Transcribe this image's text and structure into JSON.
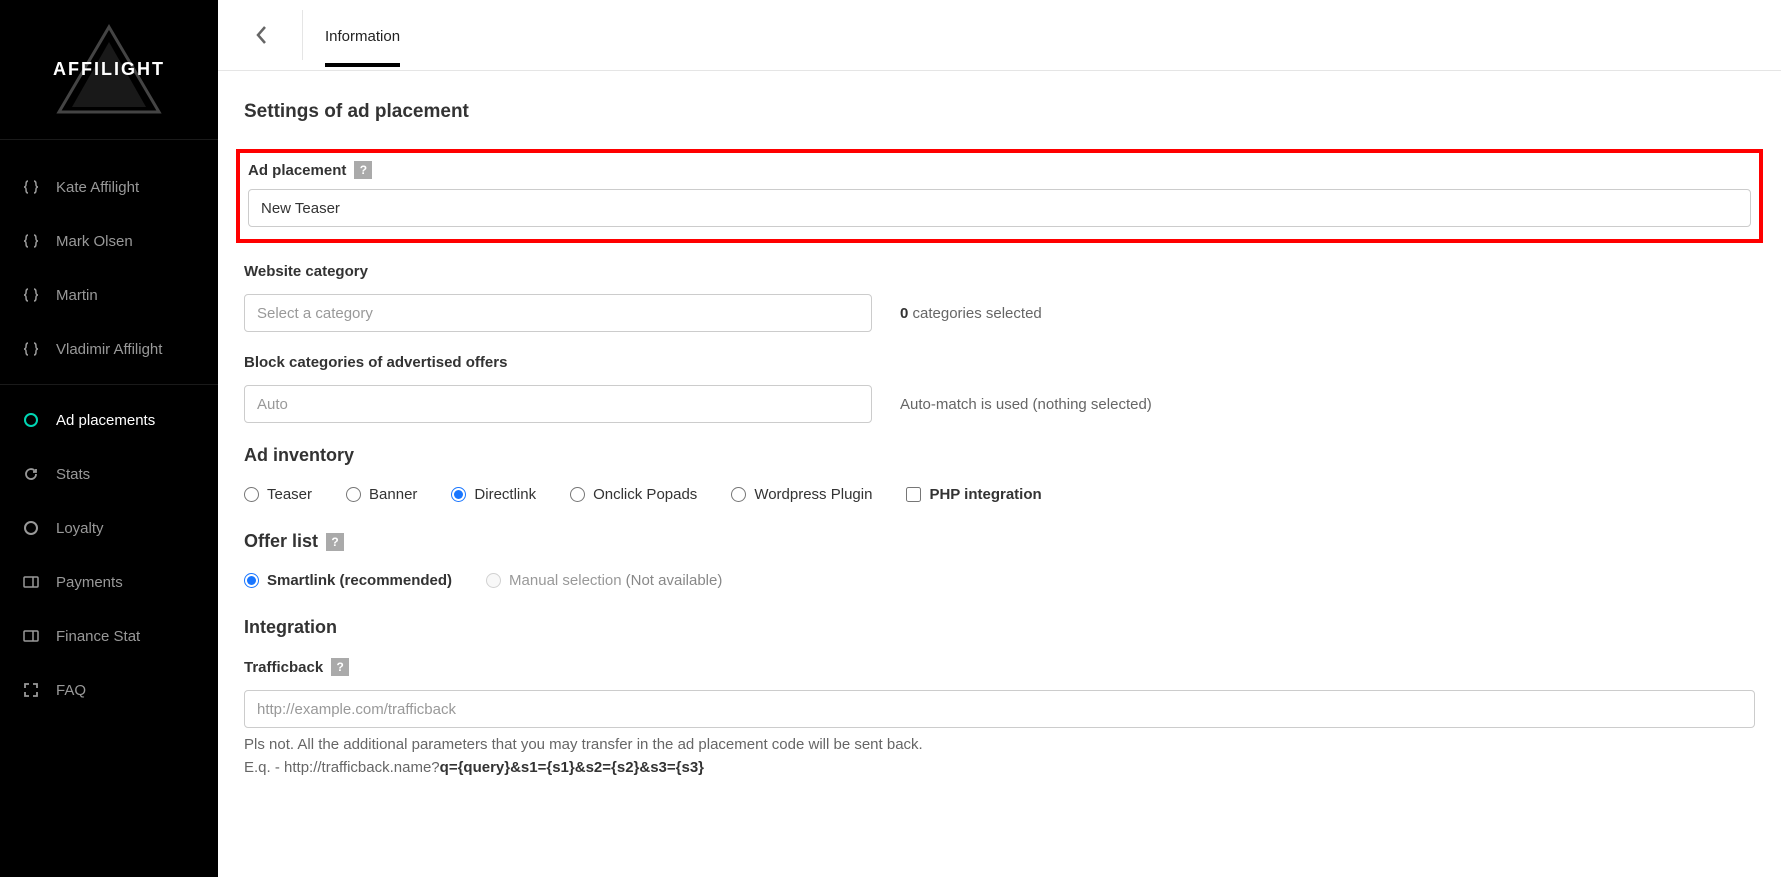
{
  "sidebar": {
    "logo_text": "AFFILIGHT",
    "items": [
      {
        "label": "Kate Affilight",
        "icon": "braces"
      },
      {
        "label": "Mark Olsen",
        "icon": "braces"
      },
      {
        "label": "Martin",
        "icon": "braces"
      },
      {
        "label": "Vladimir Affilight",
        "icon": "braces"
      },
      {
        "label": "Ad placements",
        "icon": "circle-o",
        "active": true
      },
      {
        "label": "Stats",
        "icon": "refresh"
      },
      {
        "label": "Loyalty",
        "icon": "circle"
      },
      {
        "label": "Payments",
        "icon": "card"
      },
      {
        "label": "Finance Stat",
        "icon": "card"
      },
      {
        "label": "FAQ",
        "icon": "expand"
      }
    ]
  },
  "header": {
    "tab": "Information"
  },
  "settings": {
    "title": "Settings of ad placement",
    "ad_placement": {
      "label": "Ad placement",
      "value": "New Teaser"
    },
    "website_category": {
      "label": "Website category",
      "placeholder": "Select a category",
      "hint_count": "0",
      "hint_text": " categories selected"
    },
    "block_categories": {
      "label": "Block categories of advertised offers",
      "placeholder": "Auto",
      "hint": "Auto-match is used (nothing selected)"
    },
    "ad_inventory": {
      "title": "Ad inventory",
      "options": {
        "teaser": "Teaser",
        "banner": "Banner",
        "directlink": "Directlink",
        "onclick": "Onclick Popads",
        "wordpress": "Wordpress Plugin",
        "php": "PHP integration"
      }
    },
    "offer_list": {
      "title": "Offer list",
      "smartlink": "Smartlink (recommended)",
      "manual": "Manual selection",
      "not_available": "(Not available)"
    },
    "integration": {
      "title": "Integration",
      "trafficback_label": "Trafficback",
      "trafficback_placeholder": "http://example.com/trafficback",
      "note_line1": "Pls not. All the additional parameters that you may transfer in the ad placement code will be sent back.",
      "note_line2a": "E.q. - http://trafficback.name?",
      "note_line2b": "q={query}&s1={s1}&s2={s2}&s3={s3}"
    }
  }
}
